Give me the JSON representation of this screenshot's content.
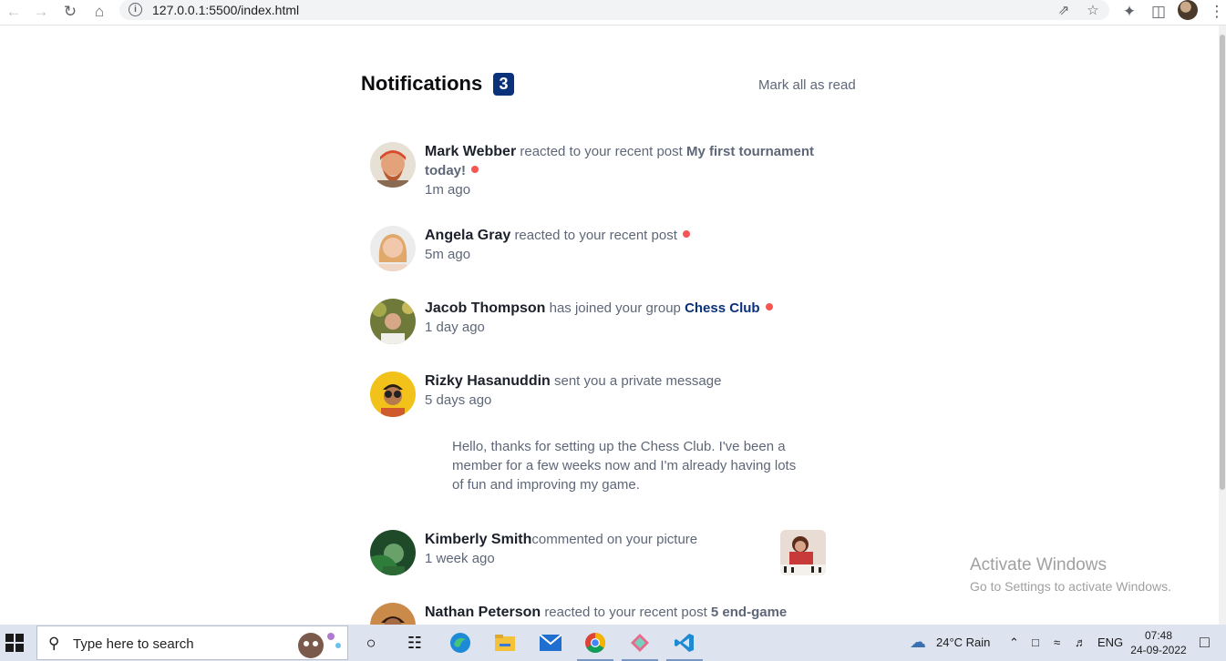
{
  "browser": {
    "url": "127.0.0.1:5500/index.html"
  },
  "header": {
    "title": "Notifications",
    "unread_count": "3",
    "mark_all_label": "Mark all as read"
  },
  "notifications": [
    {
      "name": "Mark Webber",
      "action": "reacted to your recent post",
      "target": "My first tournament today!",
      "time": "1m ago",
      "unread": true
    },
    {
      "name": "Angela Gray",
      "action": "reacted to your recent post",
      "time": "5m ago",
      "unread": true
    },
    {
      "name": "Jacob Thompson",
      "action": "has joined your group",
      "target": "Chess Club",
      "time": "1 day ago",
      "unread": true
    },
    {
      "name": "Rizky Hasanuddin",
      "action": "sent you a private message",
      "time": "5 days ago",
      "message": "Hello, thanks for setting up the Chess Club. I've been a member for a few weeks now and I'm already having lots of fun and improving my game.",
      "unread": false
    },
    {
      "name": "Kimberly Smith",
      "action": "commented on your picture",
      "time": "1 week ago",
      "unread": false
    },
    {
      "name": "Nathan Peterson",
      "action": "reacted to your recent post",
      "target": "5 end-game",
      "unread": false
    }
  ],
  "watermark": {
    "line1": "Activate Windows",
    "line2": "Go to Settings to activate Windows."
  },
  "taskbar": {
    "search_placeholder": "Type here to search",
    "weather": "24°C  Rain",
    "language": "ENG",
    "time": "07:48",
    "date": "24-09-2022"
  },
  "colors": {
    "accent": "#0a327b",
    "unread_dot": "#f65552",
    "text_dark": "#1c202b",
    "text_muted": "#5e6778"
  }
}
